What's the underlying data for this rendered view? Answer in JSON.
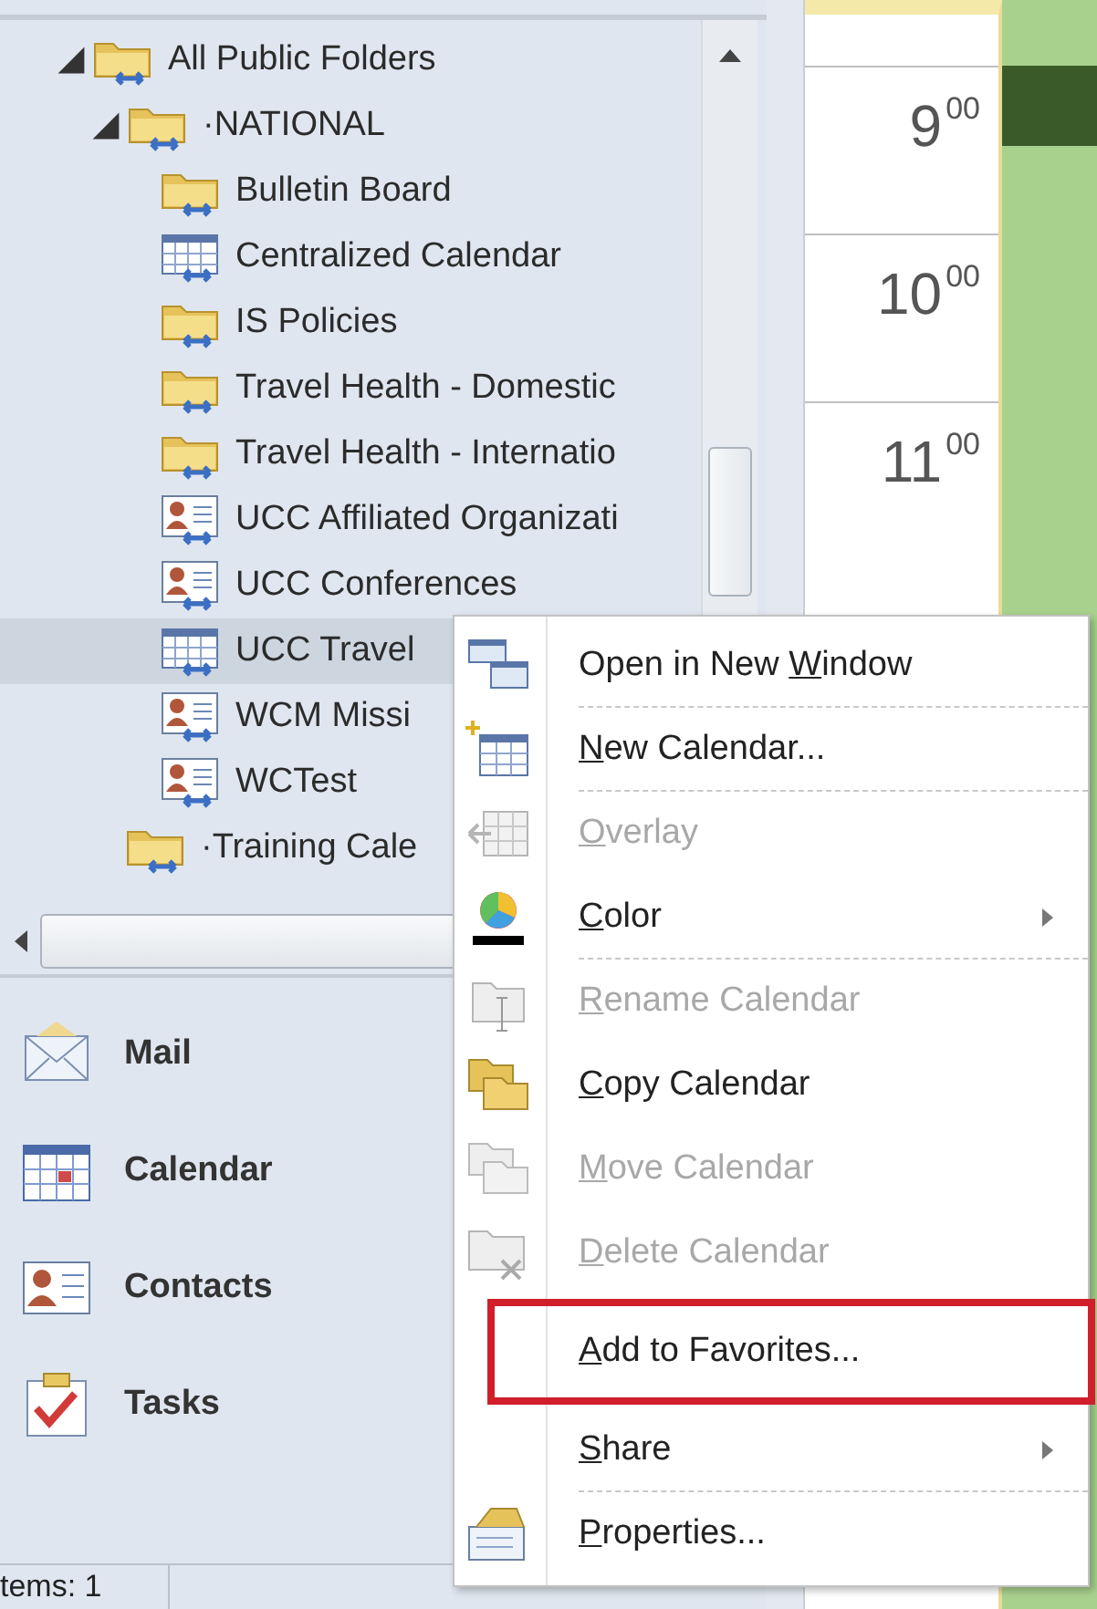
{
  "folder_tree": [
    {
      "label": "All Public Folders",
      "kind": "folder",
      "expanded": true,
      "selected": false,
      "children": [
        {
          "label": "·NATIONAL",
          "kind": "folder",
          "expanded": true,
          "selected": false,
          "children": [
            {
              "label": "Bulletin Board",
              "kind": "folder",
              "selected": false
            },
            {
              "label": "Centralized Calendar",
              "kind": "calendar",
              "selected": false
            },
            {
              "label": "IS Policies",
              "kind": "folder",
              "selected": false
            },
            {
              "label": "Travel Health - Domestic",
              "kind": "folder",
              "selected": false
            },
            {
              "label": "Travel Health - Internatio",
              "kind": "folder",
              "selected": false
            },
            {
              "label": "UCC Affiliated Organizati",
              "kind": "contacts",
              "selected": false
            },
            {
              "label": "UCC Conferences",
              "kind": "contacts",
              "selected": false
            },
            {
              "label": "UCC Travel",
              "kind": "calendar",
              "selected": true
            },
            {
              "label": "WCM Missi",
              "kind": "contacts",
              "selected": false
            },
            {
              "label": "WCTest",
              "kind": "contacts",
              "selected": false
            }
          ]
        },
        {
          "label": "·Training Cale",
          "kind": "folder",
          "selected": false
        }
      ]
    }
  ],
  "navigation": [
    {
      "label": "Mail"
    },
    {
      "label": "Calendar"
    },
    {
      "label": "Contacts"
    },
    {
      "label": "Tasks"
    }
  ],
  "status_bar": {
    "items": "tems: 1"
  },
  "time_slots": [
    {
      "hour": "9",
      "minutes": "00"
    },
    {
      "hour": "10",
      "minutes": "00"
    },
    {
      "hour": "11",
      "minutes": "00"
    }
  ],
  "context_menu": [
    {
      "pre": "Open in New ",
      "key": "W",
      "post": "indow",
      "disabled": false,
      "submenu": false,
      "separator_after": true,
      "annotated": false
    },
    {
      "key": "N",
      "post": "ew Calendar...",
      "disabled": false,
      "submenu": false,
      "separator_after": true,
      "annotated": false
    },
    {
      "key": "O",
      "post": "verlay",
      "disabled": true,
      "submenu": false,
      "separator_after": false,
      "annotated": false
    },
    {
      "key": "C",
      "post": "olor",
      "disabled": false,
      "submenu": true,
      "separator_after": true,
      "annotated": false
    },
    {
      "key": "R",
      "post": "ename Calendar",
      "disabled": true,
      "submenu": false,
      "separator_after": false,
      "annotated": false
    },
    {
      "key": "C",
      "post": "opy Calendar",
      "disabled": false,
      "submenu": false,
      "separator_after": false,
      "annotated": false
    },
    {
      "key": "M",
      "post": "ove Calendar",
      "disabled": true,
      "submenu": false,
      "separator_after": false,
      "annotated": false
    },
    {
      "key": "D",
      "post": "elete Calendar",
      "disabled": true,
      "submenu": false,
      "separator_after": false,
      "annotated": false
    },
    {
      "key": "A",
      "post": "dd to Favorites...",
      "disabled": false,
      "submenu": false,
      "separator_after": false,
      "annotated": true
    },
    {
      "key": "S",
      "post": "hare",
      "disabled": false,
      "submenu": true,
      "separator_after": true,
      "annotated": false
    },
    {
      "key": "P",
      "post": "roperties...",
      "disabled": false,
      "submenu": false,
      "separator_after": false,
      "annotated": false
    }
  ]
}
